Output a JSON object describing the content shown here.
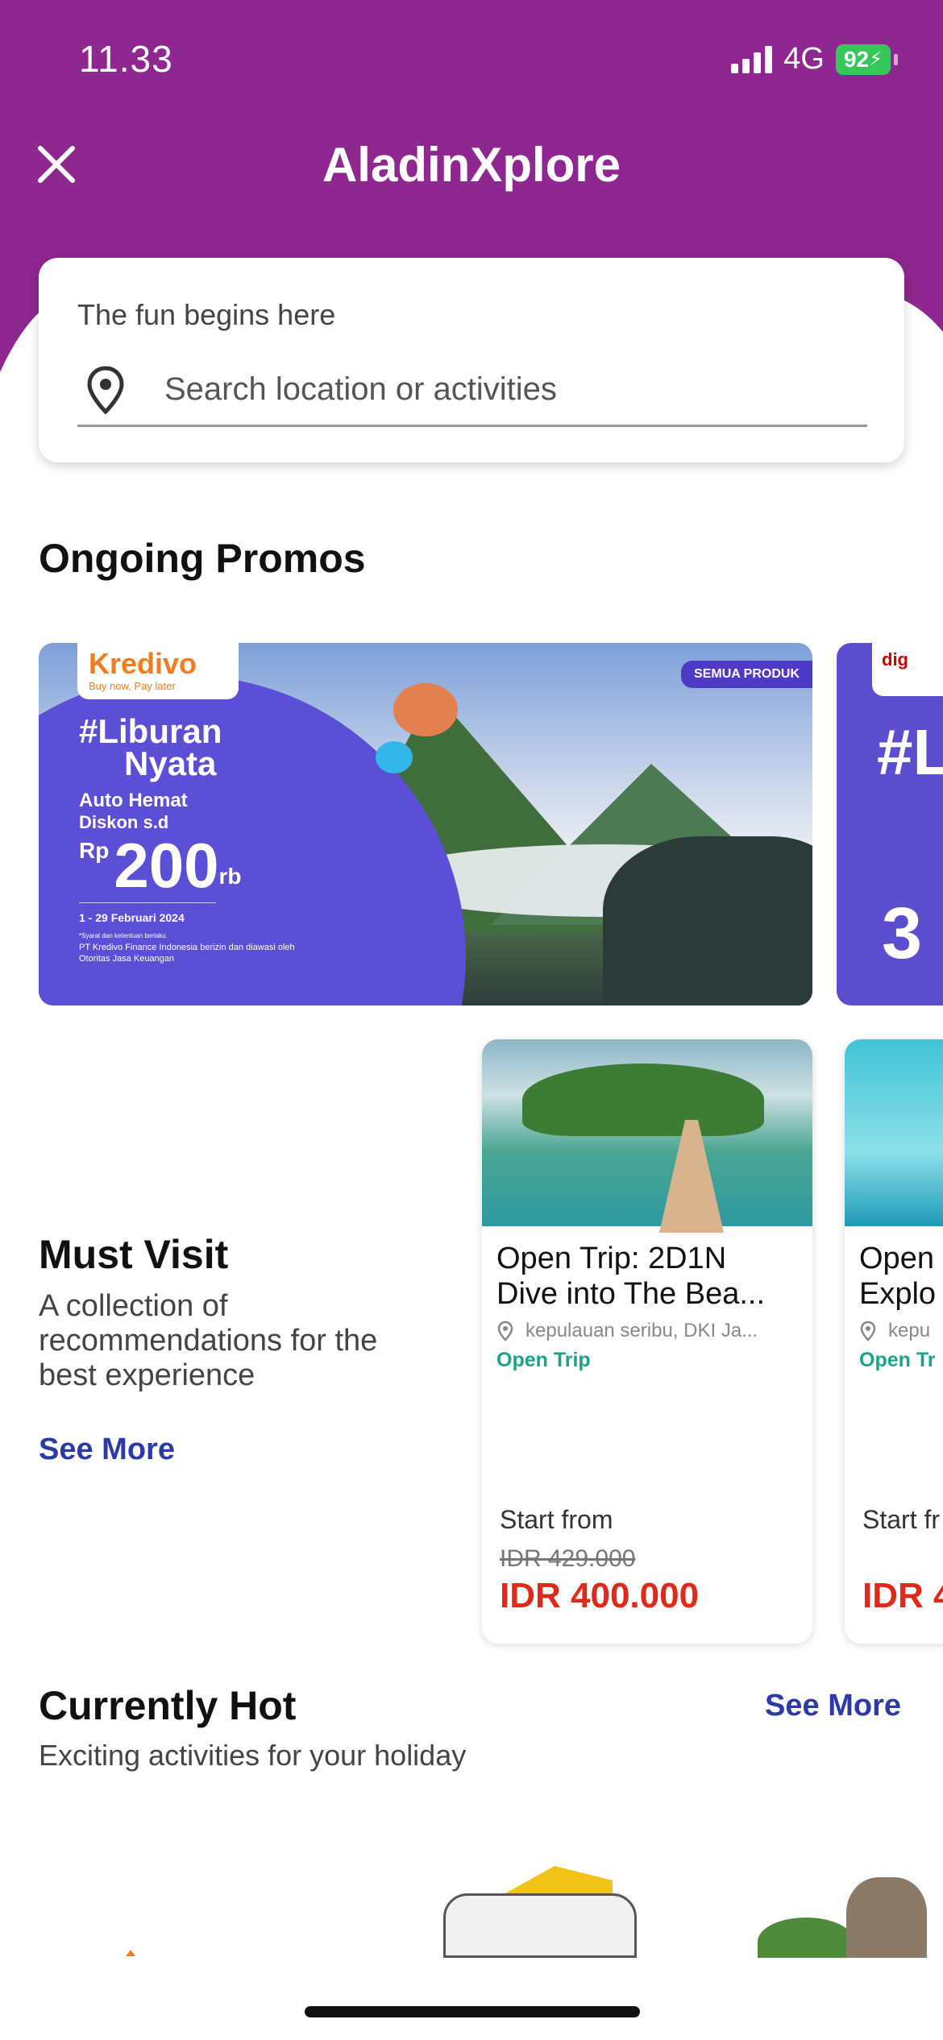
{
  "status_bar": {
    "time": "11.33",
    "network": "4G",
    "battery": "92"
  },
  "header": {
    "title": "AladinXplore",
    "close_icon": "close-icon"
  },
  "search": {
    "label": "The fun begins here",
    "placeholder": "Search location or activities"
  },
  "promos": {
    "title": "Ongoing Promos",
    "items": [
      {
        "brand": "Kredivo",
        "brand_tagline": "Buy now, Pay later",
        "badge": "SEMUA PRODUK",
        "hashtag_line1": "#Liburan",
        "hashtag_line2": "Nyata",
        "subtitle": "Auto Hemat",
        "discount_label": "Diskon s.d",
        "currency": "Rp",
        "amount": "200",
        "amount_suffix": "rb",
        "period": "1 - 29 Februari 2024",
        "fine_print_1": "*Syarat dan ketentuan berlaku.",
        "fine_print_2": "PT Kredivo Finance Indonesia berizin dan diawasi oleh Otoritas Jasa Keuangan"
      },
      {
        "brand": "dig",
        "hashtag": "#L",
        "amount": "3"
      }
    ]
  },
  "must_visit": {
    "title": "Must Visit",
    "description": "A collection of recommendations for the best experience",
    "see_more": "See More",
    "cards": [
      {
        "title_line1": "Open Trip: 2D1N",
        "title_line2": "Dive into The Bea...",
        "location": "kepulauan seribu, DKI Ja...",
        "category": "Open Trip",
        "start_label": "Start from",
        "old_price": "IDR 429.000",
        "price": "IDR 400.000"
      },
      {
        "title_line1": "Open",
        "title_line2": "Explo",
        "location": "kepu",
        "category": "Open Tr",
        "start_label": "Start fr",
        "price": "IDR 4"
      }
    ]
  },
  "currently_hot": {
    "title": "Currently Hot",
    "subtitle": "Exciting activities for your holiday",
    "see_more": "See More"
  },
  "colors": {
    "header_purple": "#8e278f",
    "link_blue": "#2b3aa6",
    "price_red": "#e02a19",
    "category_green": "#19a387"
  }
}
